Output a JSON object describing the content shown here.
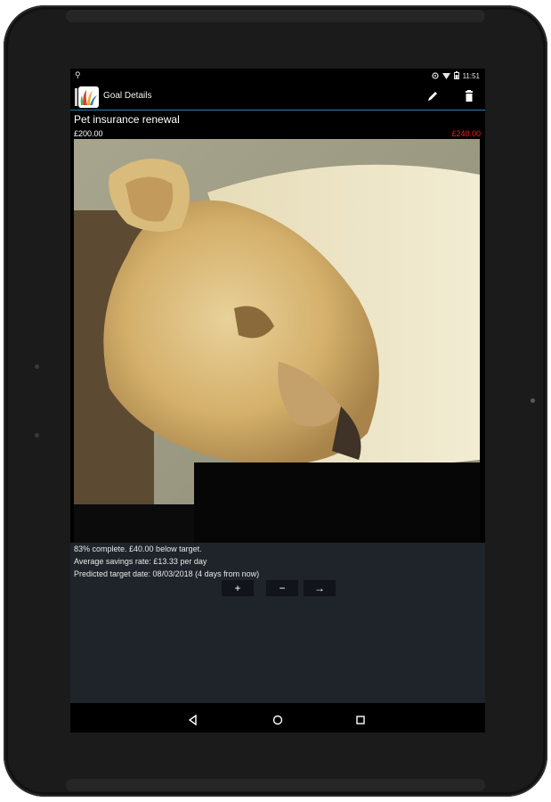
{
  "status_bar": {
    "notification_icon": "pin-icon",
    "time": "11:51",
    "icons": [
      "sync-icon",
      "wifi-icon",
      "battery-icon"
    ]
  },
  "action_bar": {
    "title": "Goal Details",
    "app_icon": "colorful-app-logo-icon",
    "actions": [
      "edit-icon",
      "delete-icon"
    ]
  },
  "goal": {
    "name": "Pet insurance renewal",
    "saved": "£200.00",
    "target": "£240.00",
    "target_color": "#ff1a1a"
  },
  "photo": {
    "subject_icon": "lioness-photo"
  },
  "progress": {
    "line1": "83% complete. £40.00 below target.",
    "line2": "Average savings rate: £13.33 per day",
    "line3": "Predicted target date: 08/03/2018 (4 days from now)"
  },
  "controls": {
    "add_label": "+",
    "subtract_label": "−",
    "next_label": "→"
  },
  "nav_bar": {
    "icons": [
      "back-icon",
      "home-icon",
      "recents-icon"
    ]
  },
  "colors": {
    "accent": "#2a7fb6",
    "content_bg": "#1f232a",
    "bezel": "#1b1b1b"
  }
}
